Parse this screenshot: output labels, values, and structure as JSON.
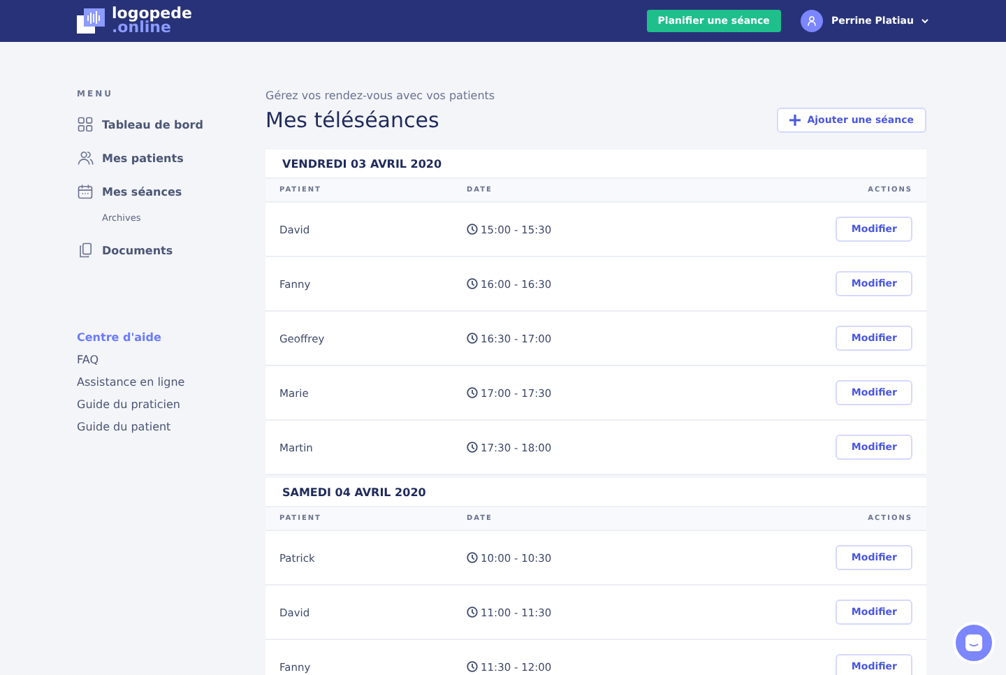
{
  "header": {
    "logo_top": "logopede",
    "logo_bottom": ".online",
    "cta": "Planifier une séance",
    "user": "Perrine Platiau"
  },
  "sidebar": {
    "menu_label": "MENU",
    "items": [
      {
        "label": "Tableau de bord"
      },
      {
        "label": "Mes patients"
      },
      {
        "label": "Mes séances",
        "children": [
          "Archives"
        ]
      },
      {
        "label": "Documents"
      }
    ],
    "help_title": "Centre d'aide",
    "help_links": [
      "FAQ",
      "Assistance en ligne",
      "Guide du praticien",
      "Guide du patient"
    ]
  },
  "page": {
    "subtitle": "Gérez vos rendez-vous avec vos patients",
    "title": "Mes téléséances",
    "add_button": "Ajouter une séance"
  },
  "days": [
    {
      "title": "VENDREDI 03 AVRIL 2020",
      "columns": [
        "PATIENT",
        "DATE",
        "ACTIONS"
      ],
      "rows": [
        {
          "patient": "David",
          "time": "15:00 - 15:30",
          "action": "Modifier"
        },
        {
          "patient": "Fanny",
          "time": "16:00 - 16:30",
          "action": "Modifier"
        },
        {
          "patient": "Geoffrey",
          "time": "16:30 - 17:00",
          "action": "Modifier"
        },
        {
          "patient": "Marie",
          "time": "17:00 - 17:30",
          "action": "Modifier"
        },
        {
          "patient": "Martin",
          "time": "17:30 - 18:00",
          "action": "Modifier"
        }
      ]
    },
    {
      "title": "SAMEDI 04 AVRIL 2020",
      "columns": [
        "PATIENT",
        "DATE",
        "ACTIONS"
      ],
      "rows": [
        {
          "patient": "Patrick",
          "time": "10:00 - 10:30",
          "action": "Modifier"
        },
        {
          "patient": "David",
          "time": "11:00 - 11:30",
          "action": "Modifier"
        },
        {
          "patient": "Fanny",
          "time": "11:30 - 12:00",
          "action": "Modifier"
        }
      ]
    }
  ]
}
